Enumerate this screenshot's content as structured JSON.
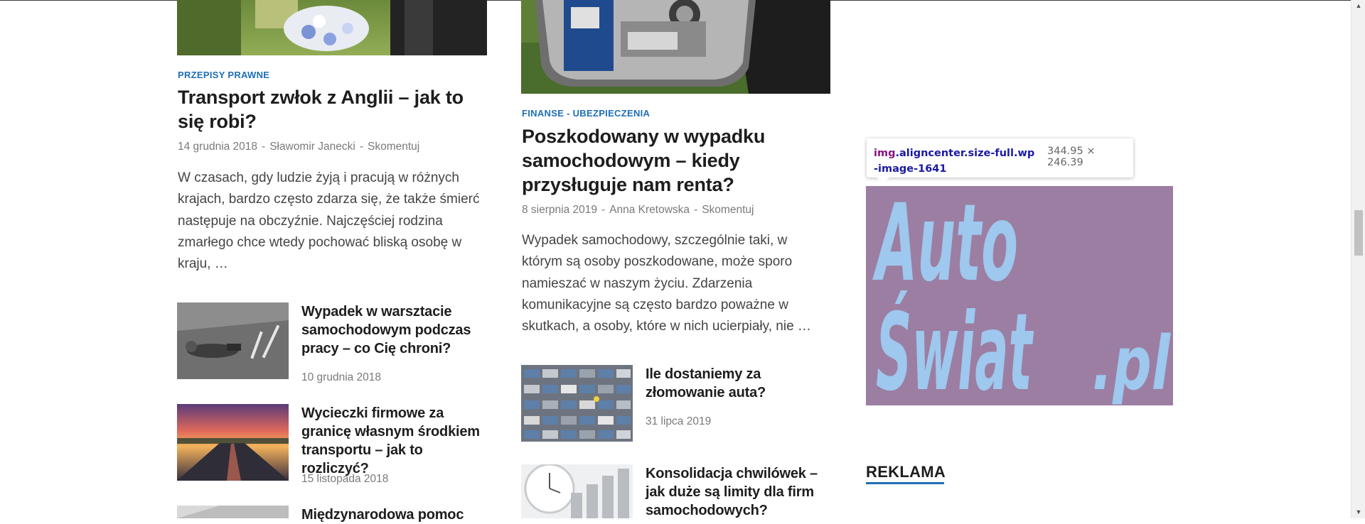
{
  "col1": {
    "main_article": {
      "category": "PRZEPISY PRAWNE",
      "title": "Transport zwłok z Anglii – jak to się robi?",
      "date": "14 grudnia 2018",
      "author": "Sławomir Janecki",
      "comment": "Skomentuj",
      "separator": "-",
      "excerpt": "W czasach, gdy ludzie żyją i pracują w różnych krajach, bardzo często zdarza się, że także śmierć następuje na obczyźnie. Najczęściej rodzina zmarłego chce wtedy pochować bliską osobę w kraju, …"
    },
    "small_articles": [
      {
        "title": "Wypadek w warsztacie samochodowym podczas pracy – co Cię chroni?",
        "date": "10 grudnia 2018"
      },
      {
        "title": "Wycieczki firmowe za granicę własnym środkiem transportu – jak to rozliczyć?",
        "date": "15 listopada 2018"
      },
      {
        "title": "Międzynarodowa pomoc",
        "date": ""
      }
    ]
  },
  "col2": {
    "main_article": {
      "category": "FINANSE - UBEZPIECZENIA",
      "title": "Poszkodowany w wypadku samochodowym – kiedy przysługuje nam renta?",
      "date": "8 sierpnia 2019",
      "author": "Anna Kretowska",
      "comment": "Skomentuj",
      "separator": "-",
      "excerpt": "Wypadek samochodowy, szczególnie taki, w którym są osoby poszkodowane, może sporo namieszać w naszym życiu. Zdarzenia komunikacyjne są często bardzo poważne w skutkach, a osoby, które w nich ucierpiały, nie …"
    },
    "small_articles": [
      {
        "title": "Ile dostaniemy za złomowanie auta?",
        "date": "31 lipca 2019"
      },
      {
        "title": "Konsolidacja chwilówek – jak duże są limity dla firm samochodowych?",
        "date": ""
      }
    ]
  },
  "sidebar": {
    "inspector_tooltip": {
      "tag": "img",
      "selector_rest": ".aligncenter.size-full.wp-image-1641",
      "dimensions": "344.95 × 246.39"
    },
    "logo_text": {
      "line1": "Auto",
      "line2": "Świat",
      "suffix": ".pl"
    },
    "reklama_heading": "REKLAMA"
  },
  "colors": {
    "category": "#1e6fb7",
    "highlight_overlay": "#9c7ea3",
    "logo_text": "#9ec8ee"
  },
  "icons": {
    "scroll_up": "triangle-up",
    "scroll_down": "triangle-down"
  }
}
